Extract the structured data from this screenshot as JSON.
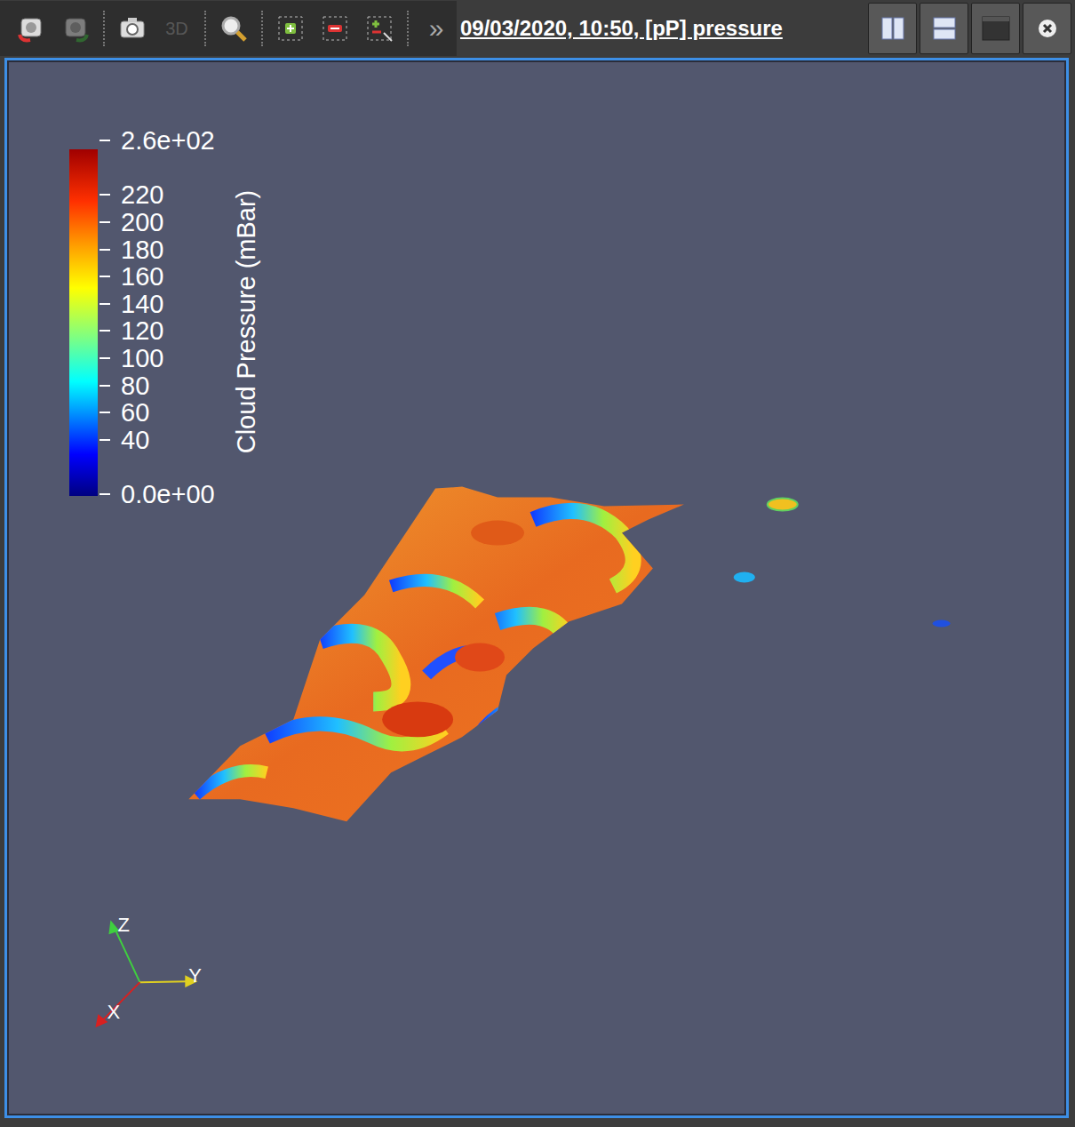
{
  "window": {
    "title": "09/03/2020, 10:50, [pP] pressure"
  },
  "toolbar": [
    {
      "kind": "icon",
      "disabled": false
    },
    {
      "kind": "icon",
      "disabled": true
    },
    {
      "kind": "icon",
      "disabled": false
    },
    {
      "kind": "text",
      "label": "3D",
      "disabled": true
    },
    {
      "kind": "icon",
      "disabled": false
    },
    {
      "kind": "icon",
      "disabled": false
    },
    {
      "kind": "icon",
      "disabled": false
    },
    {
      "kind": "icon",
      "disabled": false
    },
    {
      "kind": "text",
      "label": "»",
      "disabled": false
    }
  ],
  "view_buttons": [
    "split-horizontal",
    "split-vertical",
    "maximize",
    "close"
  ],
  "legend": {
    "title": "Cloud Pressure (mBar)",
    "ticks": [
      "2.6e+02",
      "220",
      "200",
      "180",
      "160",
      "140",
      "120",
      "100",
      "80",
      "60",
      "40",
      "0.0e+00"
    ]
  },
  "axes": [
    "X",
    "Y",
    "Z"
  ]
}
